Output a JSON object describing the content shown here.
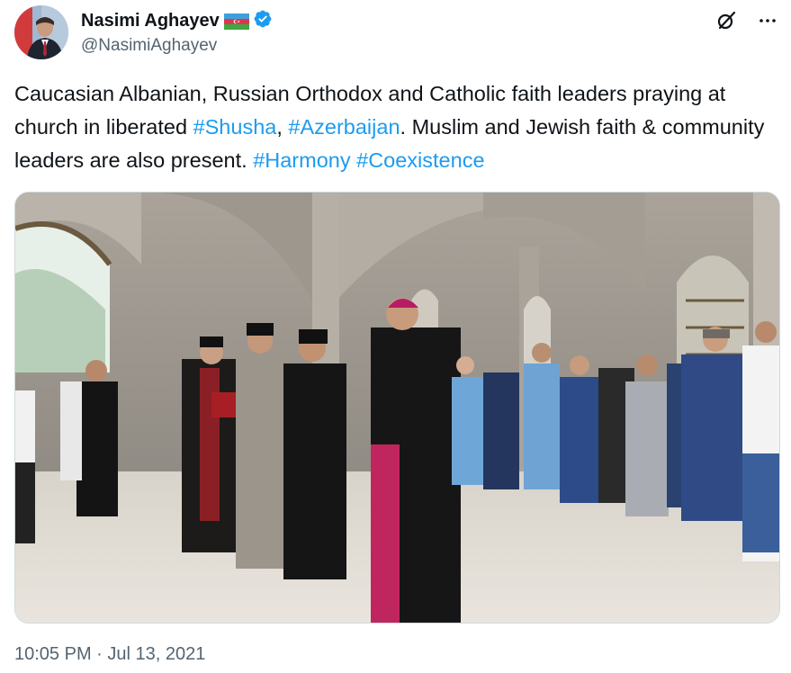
{
  "author": {
    "name": "Nasimi Aghayev",
    "handle": "@NasimiAghayev",
    "flag_icon": "azerbaijan-flag-icon",
    "verified_icon": "verified-badge-icon"
  },
  "header_actions": {
    "grok_icon": "grok-icon",
    "more_icon": "more-icon"
  },
  "tweet": {
    "text_1": "Caucasian Albanian, Russian Orthodox and Catholic faith leaders praying at church in liberated ",
    "hashtag_shusha": "#Shusha",
    "sep_1": ", ",
    "hashtag_azerbaijan": "#Azerbaijan",
    "text_2": ". Muslim and Jewish faith & community leaders are also present. ",
    "hashtag_harmony": "#Harmony",
    "sep_2": " ",
    "hashtag_coexistence": "#Coexistence"
  },
  "timestamp": {
    "time": "10:05 PM",
    "separator": " · ",
    "date": "Jul 13, 2021"
  },
  "colors": {
    "link": "#1d9bf0",
    "secondary_text": "#536471",
    "primary_text": "#0f1419"
  }
}
